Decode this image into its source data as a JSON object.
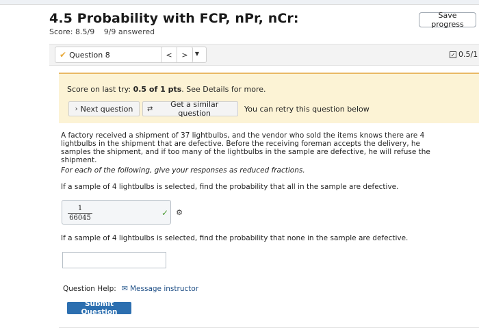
{
  "header": {
    "title": "4.5 Probability with FCP, nPr, nCr:",
    "score": "Score: 8.5/9",
    "answered": "9/9 answered",
    "save_label": "Save progress"
  },
  "question_nav": {
    "selected": "Question 8",
    "prev_symbol": "<",
    "next_symbol": ">",
    "question_score": "0.5/1"
  },
  "feedback": {
    "prefix": "Score on last try: ",
    "score_value": "0.5 of 1 pts",
    "suffix": ". See Details for more.",
    "next_label": "Next question",
    "similar_label": "Get a similar question",
    "retry_text": "You can retry this question below"
  },
  "problem": {
    "statement": "A factory received a shipment of 37 lightbulbs, and the vendor who sold the items knows there are 4 lightbulbs in the shipment that are defective. Before the receiving foreman accepts the delivery, he samples the shipment, and if too many of the lightbulbs in the sample are defective, he will refuse the shipment.",
    "instructions": "For each of the following, give your responses as reduced fractions.",
    "part1": {
      "prompt": "If a sample of 4 lightbulbs is selected, find the probability that all in the sample are defective.",
      "numerator": "1",
      "denominator": "66045",
      "status": "correct"
    },
    "part2": {
      "prompt": "If a sample of 4 lightbulbs is selected, find the probability that none in the sample are defective.",
      "value": ""
    }
  },
  "help": {
    "label": "Question Help:",
    "message_label": "Message instructor"
  },
  "submit_label": "Submit Question",
  "colors": {
    "accent": "#2c6fb0",
    "feedback_bg": "#fcf3d5",
    "feedback_border": "#e9b864",
    "correct": "#4a9a32"
  }
}
